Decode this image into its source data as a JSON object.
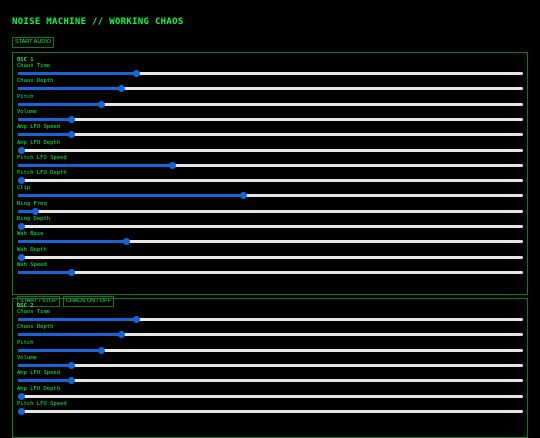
{
  "app": {
    "title": "NOISE MACHINE // WORKING CHAOS",
    "start_audio_label": "START AUDIO"
  },
  "colors": {
    "background": "#000000",
    "text": "#00ff41",
    "border": "#0b7a1f",
    "slider_fill": "#1565d8",
    "slider_track": "#e6e6e6"
  },
  "oscillators": [
    {
      "label": "OSC 1",
      "sliders": [
        {
          "label": "Chaos Time",
          "value": 0.235
        },
        {
          "label": "Chaos Depth",
          "value": 0.205
        },
        {
          "label": "Pitch",
          "value": 0.165
        },
        {
          "label": "Volume",
          "value": 0.105
        },
        {
          "label": "Amp LFO Speed",
          "value": 0.105
        },
        {
          "label": "Amp LFO Depth",
          "value": 0.0
        },
        {
          "label": "Pitch LFO Speed",
          "value": 0.305
        },
        {
          "label": "Pitch LFO Depth",
          "value": 0.0
        },
        {
          "label": "Clip",
          "value": 0.447
        },
        {
          "label": "Ring Freq",
          "value": 0.035
        },
        {
          "label": "Ring Depth",
          "value": 0.0
        },
        {
          "label": "Wah Base",
          "value": 0.215
        },
        {
          "label": "Wah Depth",
          "value": 0.0
        },
        {
          "label": "Wah Speed",
          "value": 0.105
        }
      ],
      "controls": {
        "start_stop_label": "START / STOP",
        "chaos_label": "CHAOS ON / OFF"
      }
    },
    {
      "label": "OSC 2",
      "sliders": [
        {
          "label": "Chaos Time",
          "value": 0.235
        },
        {
          "label": "Chaos Depth",
          "value": 0.205
        },
        {
          "label": "Pitch",
          "value": 0.165
        },
        {
          "label": "Volume",
          "value": 0.105
        },
        {
          "label": "Amp LFO Speed",
          "value": 0.105
        },
        {
          "label": "Amp LFO Depth",
          "value": 0.0
        },
        {
          "label": "Pitch LFO Speed",
          "value": 0.0
        }
      ]
    }
  ]
}
